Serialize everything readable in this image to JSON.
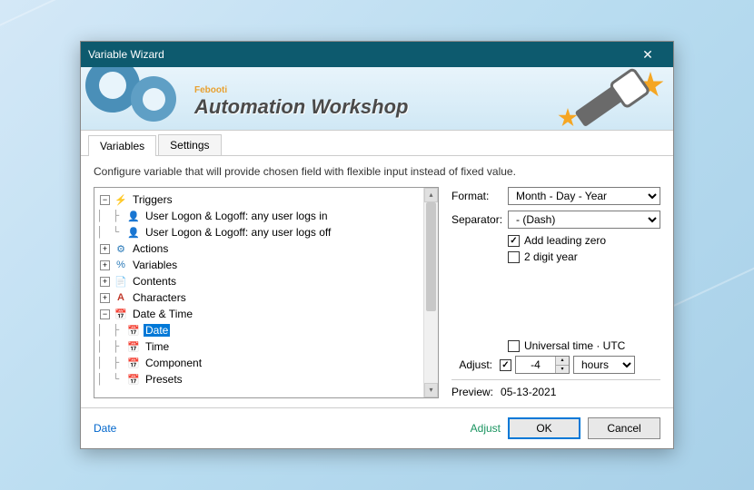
{
  "window": {
    "title": "Variable Wizard",
    "brand": "Febooti",
    "app": "Automation Workshop"
  },
  "tabs": {
    "variables": "Variables",
    "settings": "Settings"
  },
  "description": "Configure variable that will provide chosen field with flexible input instead of fixed value.",
  "tree": {
    "triggers": "Triggers",
    "trigger_login": "User Logon & Logoff: any user logs in",
    "trigger_logoff": "User Logon & Logoff: any user logs off",
    "actions": "Actions",
    "variables": "Variables",
    "contents": "Contents",
    "characters": "Characters",
    "datetime": "Date & Time",
    "date": "Date",
    "time": "Time",
    "component": "Component",
    "presets": "Presets"
  },
  "options": {
    "format_label": "Format:",
    "format_value": "Month - Day - Year",
    "separator_label": "Separator:",
    "separator_value": "- (Dash)",
    "leading_zero": "Add leading zero",
    "two_digit": "2 digit year",
    "utc": "Universal time · UTC",
    "adjust_label": "Adjust:",
    "adjust_value": "-4",
    "adjust_unit": "hours",
    "preview_label": "Preview:",
    "preview_value": "05-13-2021"
  },
  "footer": {
    "breadcrumb": "Date",
    "adjust": "Adjust",
    "ok": "OK",
    "cancel": "Cancel"
  }
}
